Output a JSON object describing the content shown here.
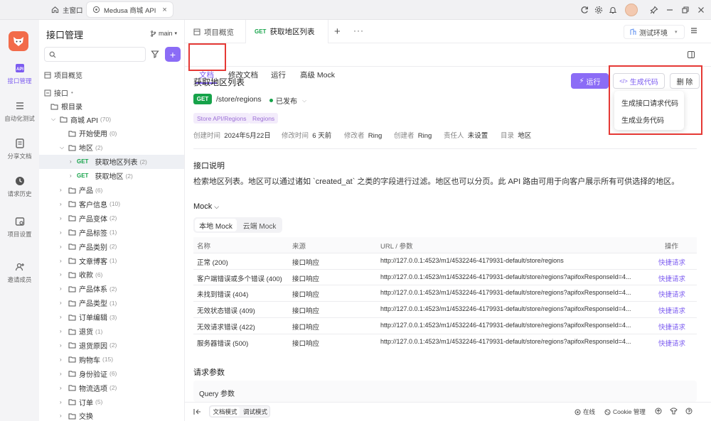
{
  "titlebar": {
    "home_tab": "主窗口",
    "project_tab": "Medusa 商城 API"
  },
  "rail": {
    "items": [
      {
        "label": "接口管理",
        "icon": "api-icon",
        "active": true
      },
      {
        "label": "自动化测试",
        "icon": "automation-icon",
        "active": false
      },
      {
        "label": "分享文档",
        "icon": "share-doc-icon",
        "active": false
      },
      {
        "label": "请求历史",
        "icon": "history-icon",
        "active": false
      },
      {
        "label": "项目设置",
        "icon": "settings-icon",
        "active": false
      },
      {
        "label": "邀请成员",
        "icon": "invite-icon",
        "active": false
      }
    ]
  },
  "sidebar": {
    "title": "接口管理",
    "branch": "main",
    "project_overview": "项目概览",
    "api_label": "接口",
    "root_dir": "根目录",
    "tree": [
      {
        "kind": "folder",
        "label": "商城 API",
        "count": "(70)",
        "expanded": true,
        "level": 1
      },
      {
        "kind": "folder",
        "label": "开始使用",
        "count": "(0)",
        "expanded": false,
        "level": 2,
        "noarrow": true
      },
      {
        "kind": "folder",
        "label": "地区",
        "count": "(2)",
        "expanded": true,
        "level": 2
      },
      {
        "kind": "api",
        "method": "GET",
        "label": "获取地区列表",
        "count": "(2)",
        "level": 3,
        "selected": true
      },
      {
        "kind": "api",
        "method": "GET",
        "label": "获取地区",
        "count": "(2)",
        "level": 3
      },
      {
        "kind": "folder",
        "label": "产品",
        "count": "(6)",
        "level": 2
      },
      {
        "kind": "folder",
        "label": "客户信息",
        "count": "(10)",
        "level": 2
      },
      {
        "kind": "folder",
        "label": "产品变体",
        "count": "(2)",
        "level": 2
      },
      {
        "kind": "folder",
        "label": "产品标签",
        "count": "(1)",
        "level": 2
      },
      {
        "kind": "folder",
        "label": "产品类别",
        "count": "(2)",
        "level": 2
      },
      {
        "kind": "folder",
        "label": "文章博客",
        "count": "(1)",
        "level": 2
      },
      {
        "kind": "folder",
        "label": "收款",
        "count": "(6)",
        "level": 2
      },
      {
        "kind": "folder",
        "label": "产品体系",
        "count": "(2)",
        "level": 2
      },
      {
        "kind": "folder",
        "label": "产品类型",
        "count": "(1)",
        "level": 2
      },
      {
        "kind": "folder",
        "label": "订单编辑",
        "count": "(3)",
        "level": 2
      },
      {
        "kind": "folder",
        "label": "退货",
        "count": "(1)",
        "level": 2
      },
      {
        "kind": "folder",
        "label": "退货原因",
        "count": "(2)",
        "level": 2
      },
      {
        "kind": "folder",
        "label": "购物车",
        "count": "(15)",
        "level": 2
      },
      {
        "kind": "folder",
        "label": "身份验证",
        "count": "(6)",
        "level": 2
      },
      {
        "kind": "folder",
        "label": "物流选项",
        "count": "(2)",
        "level": 2
      },
      {
        "kind": "folder",
        "label": "订单",
        "count": "(5)",
        "level": 2
      },
      {
        "kind": "folder",
        "label": "交换",
        "count": "",
        "level": 2
      }
    ]
  },
  "tabs": [
    {
      "label": "项目概览"
    },
    {
      "method": "GET",
      "label": "获取地区列表"
    }
  ],
  "env": "测试环境",
  "subtabs": [
    "文档",
    "修改文档",
    "运行",
    "高级 Mock"
  ],
  "doc": {
    "title": "获取地区列表",
    "method": "GET",
    "path": "/store/regions",
    "status": "已发布",
    "tags": [
      "Store API/Regions",
      "Regions"
    ],
    "meta": {
      "created_label": "创建时间",
      "created": "2024年5月22日",
      "modified_label": "修改时间",
      "modified": "6 天前",
      "modifier_label": "修改者",
      "modifier": "Ring",
      "creator_label": "创建者",
      "creator": "Ring",
      "owner_label": "责任人",
      "owner": "未设置",
      "dir_label": "目录",
      "dir": "地区"
    },
    "run_label": "运行",
    "gen_label": "生成代码",
    "del_label": "删 除",
    "menu": [
      "生成接口请求代码",
      "生成业务代码"
    ],
    "desc_title": "接口说明",
    "desc": "检索地区列表。地区可以通过诸如 `created_at` 之类的字段进行过滤。地区也可以分页。此 API 路由可用于向客户展示所有可供选择的地区。",
    "mock_title": "Mock",
    "mock_tabs": [
      "本地 Mock",
      "云端 Mock"
    ],
    "mock_headers": [
      "名称",
      "来源",
      "URL / 参数",
      "操作"
    ],
    "mock_rows": [
      {
        "name": "正常 (200)",
        "source": "接口响应",
        "url": "http://127.0.0.1:4523/m1/4532246-4179931-default/store/regions",
        "action": "快捷请求"
      },
      {
        "name": "客户端错误或多个错误 (400)",
        "source": "接口响应",
        "url": "http://127.0.0.1:4523/m1/4532246-4179931-default/store/regions?apifoxResponseId=4...",
        "action": "快捷请求"
      },
      {
        "name": "未找到错误 (404)",
        "source": "接口响应",
        "url": "http://127.0.0.1:4523/m1/4532246-4179931-default/store/regions?apifoxResponseId=4...",
        "action": "快捷请求"
      },
      {
        "name": "无效状态错误 (409)",
        "source": "接口响应",
        "url": "http://127.0.0.1:4523/m1/4532246-4179931-default/store/regions?apifoxResponseId=4...",
        "action": "快捷请求"
      },
      {
        "name": "无效请求错误 (422)",
        "source": "接口响应",
        "url": "http://127.0.0.1:4523/m1/4532246-4179931-default/store/regions?apifoxResponseId=4...",
        "action": "快捷请求"
      },
      {
        "name": "服务器错误 (500)",
        "source": "接口响应",
        "url": "http://127.0.0.1:4523/m1/4532246-4179931-default/store/regions?apifoxResponseId=4...",
        "action": "快捷请求"
      }
    ],
    "req_title": "请求参数",
    "query_title": "Query 参数"
  },
  "footer": {
    "doc_mode": "文档模式",
    "debug_mode": "调试模式",
    "online": "在线",
    "cookie": "Cookie 管理"
  },
  "colors": {
    "accent": "#7c5cf0",
    "get": "#16a34a",
    "highlight": "#e53935"
  }
}
